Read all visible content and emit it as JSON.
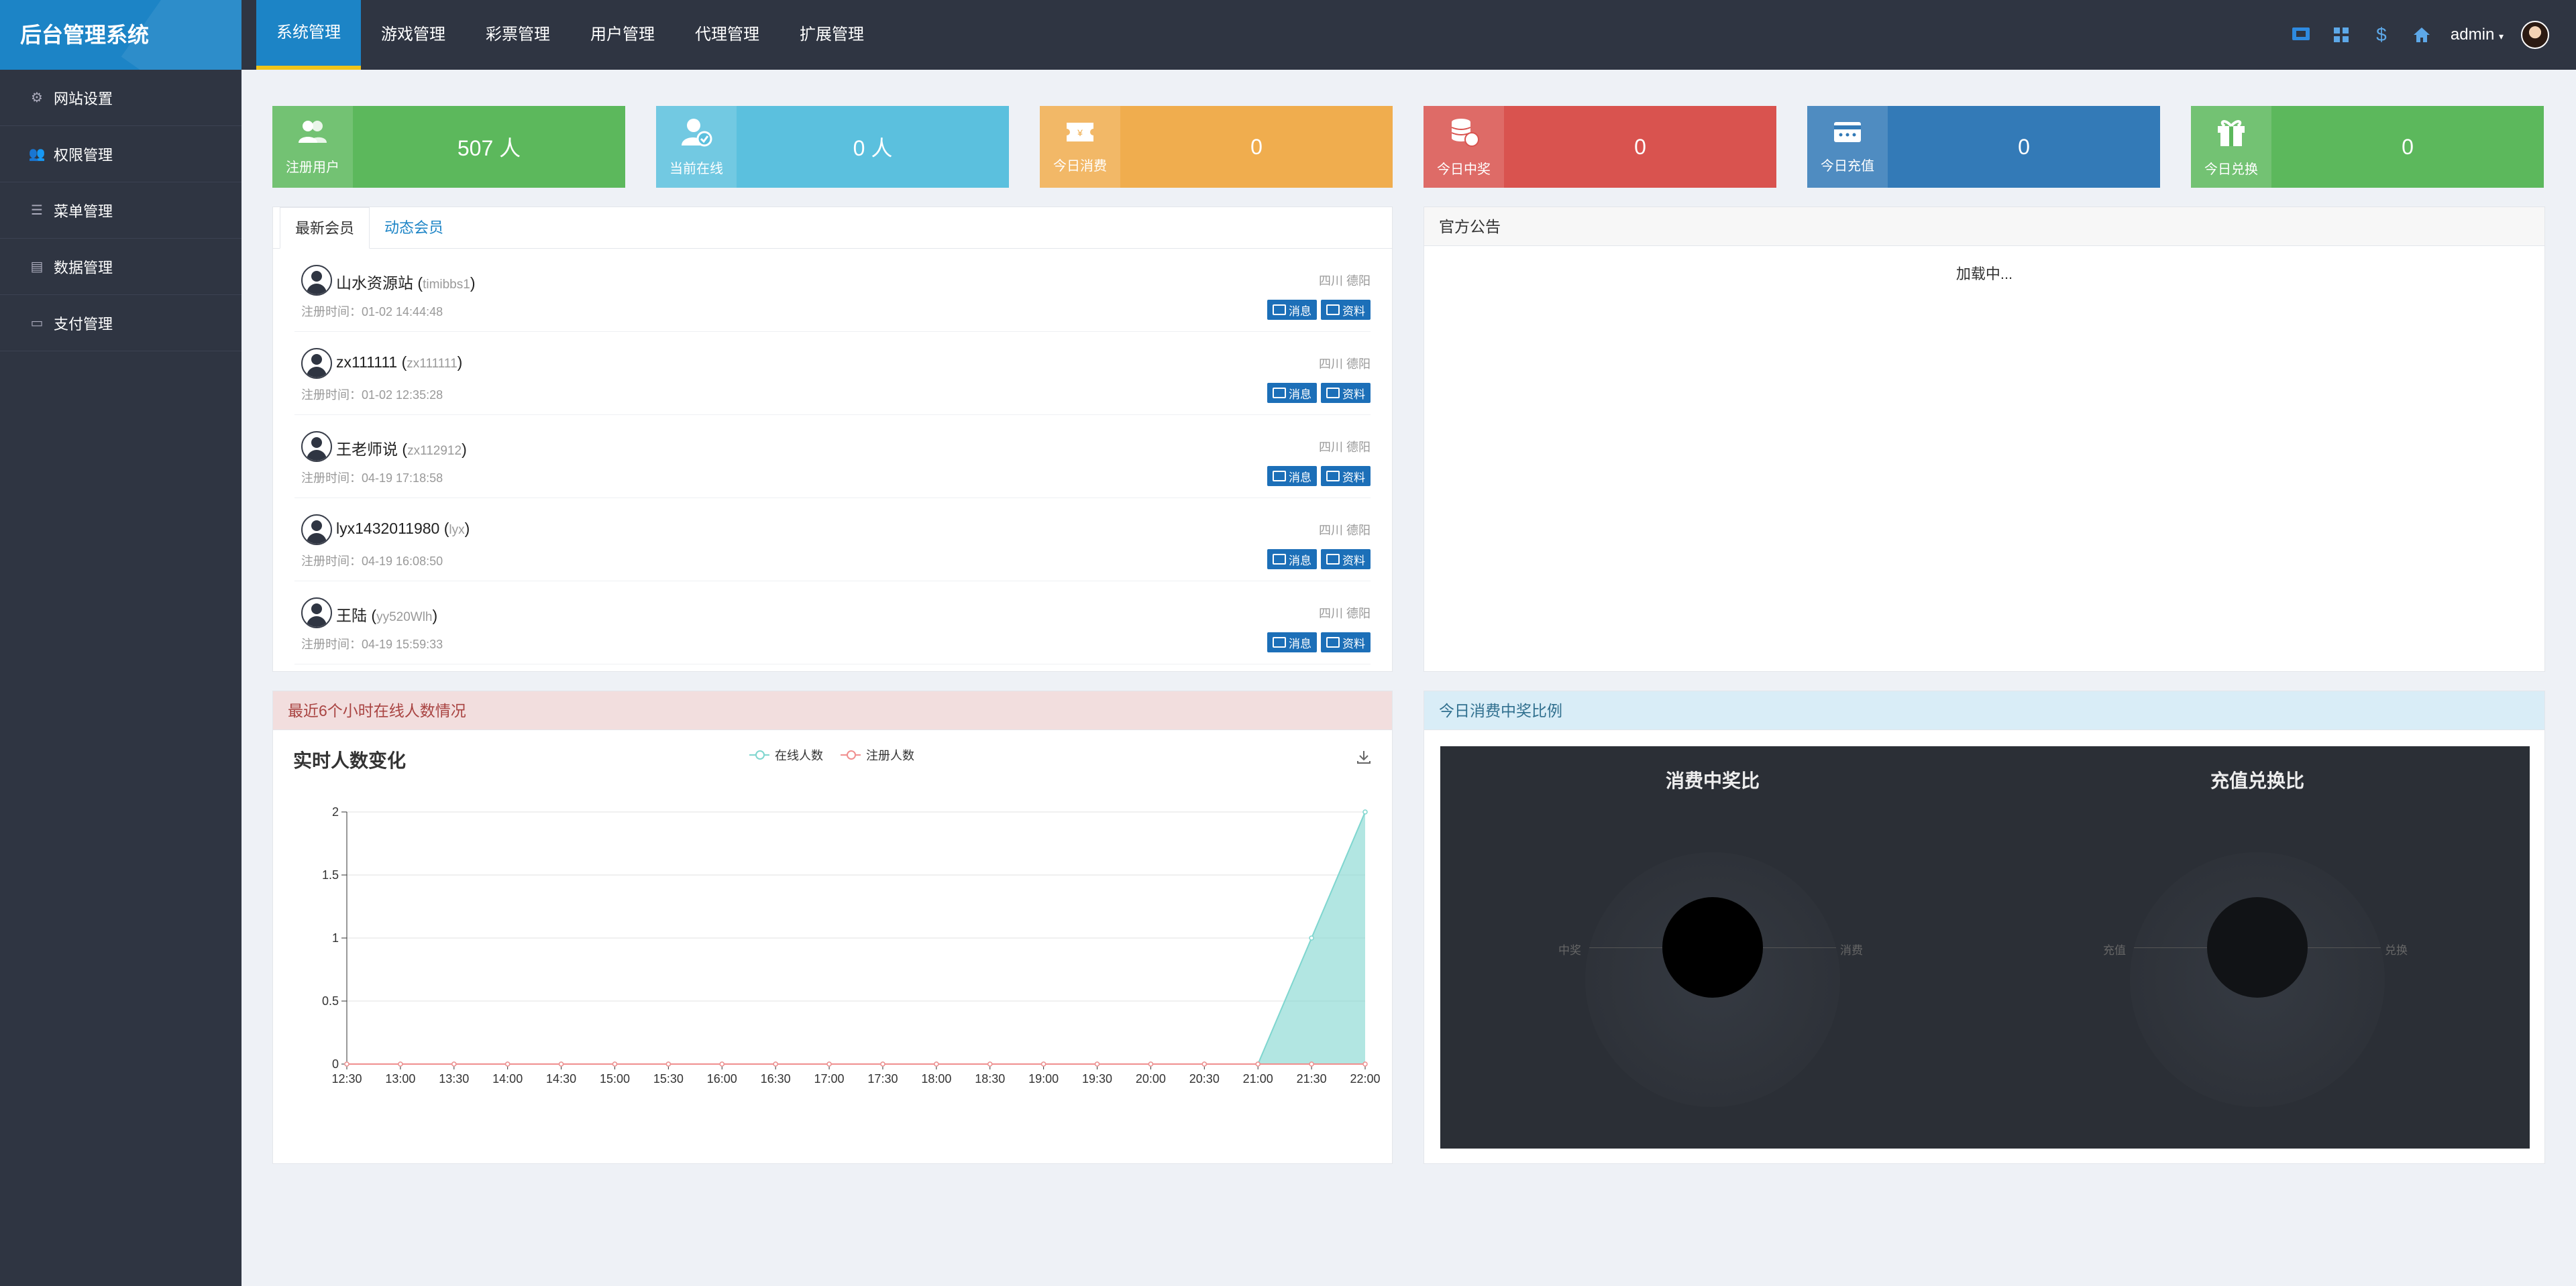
{
  "app": {
    "title": "后台管理系统",
    "user": "admin"
  },
  "topnav": [
    "系统管理",
    "游戏管理",
    "彩票管理",
    "用户管理",
    "代理管理",
    "扩展管理"
  ],
  "topicons": [
    "monitor-icon",
    "grid-icon",
    "dollar-icon",
    "home-icon"
  ],
  "sidebar": [
    "网站设置",
    "权限管理",
    "菜单管理",
    "数据管理",
    "支付管理"
  ],
  "stats": [
    {
      "label": "注册用户",
      "value": "507 人",
      "color": "#5cb85c",
      "icon": "users-icon"
    },
    {
      "label": "当前在线",
      "value": "0 人",
      "color": "#5bc0de",
      "icon": "user-check-icon"
    },
    {
      "label": "今日消费",
      "value": "0",
      "color": "#f0ad4e",
      "icon": "ticket-icon"
    },
    {
      "label": "今日中奖",
      "value": "0",
      "color": "#d9534f",
      "icon": "coins-icon"
    },
    {
      "label": "今日充值",
      "value": "0",
      "color": "#337ab7",
      "icon": "card-icon"
    },
    {
      "label": "今日兑换",
      "value": "0",
      "color": "#5cb85c",
      "icon": "gift-icon"
    }
  ],
  "members": {
    "tabs": [
      "最新会员",
      "动态会员"
    ],
    "rows": [
      {
        "name": "山水资源站",
        "account": "timibbs1",
        "reg_time": "注册时间：01-02 14:44:48",
        "location": "四川 德阳"
      },
      {
        "name": "zx111111",
        "account": "zx111111",
        "reg_time": "注册时间：01-02 12:35:28",
        "location": "四川 德阳"
      },
      {
        "name": "王老师说",
        "account": "zx112912",
        "reg_time": "注册时间：04-19 17:18:58",
        "location": "四川 德阳"
      },
      {
        "name": "lyx1432011980",
        "account": "lyx",
        "reg_time": "注册时间：04-19 16:08:50",
        "location": "四川 德阳"
      },
      {
        "name": "王陆",
        "account": "yy520Wlh",
        "reg_time": "注册时间：04-19 15:59:33",
        "location": "四川 德阳"
      }
    ],
    "btn_message": "消息",
    "btn_profile": "资料"
  },
  "announce": {
    "title": "官方公告",
    "loading": "加载中..."
  },
  "online_panel": {
    "title": "最近6个小时在线人数情况"
  },
  "ratio_panel": {
    "title": "今日消费中奖比例"
  },
  "chart_data": [
    {
      "type": "area",
      "title": "实时人数变化",
      "x": [
        "12:30",
        "13:00",
        "13:30",
        "14:00",
        "14:30",
        "15:00",
        "15:30",
        "16:00",
        "16:30",
        "17:00",
        "17:30",
        "18:00",
        "18:30",
        "19:00",
        "19:30",
        "20:00",
        "20:30",
        "21:00",
        "21:30",
        "22:00"
      ],
      "ylim": [
        0,
        2
      ],
      "yticks": [
        0,
        0.5,
        1,
        1.5,
        2
      ],
      "series": [
        {
          "name": "在线人数",
          "color": "#7fd6cf",
          "values": [
            0,
            0,
            0,
            0,
            0,
            0,
            0,
            0,
            0,
            0,
            0,
            0,
            0,
            0,
            0,
            0,
            0,
            0,
            1,
            2
          ]
        },
        {
          "name": "注册人数",
          "color": "#f08e8e",
          "values": [
            0,
            0,
            0,
            0,
            0,
            0,
            0,
            0,
            0,
            0,
            0,
            0,
            0,
            0,
            0,
            0,
            0,
            0,
            0,
            0
          ]
        }
      ],
      "legend": "top-center",
      "grid": true
    },
    {
      "type": "pie",
      "title": "消费中奖比",
      "labels": [
        "中奖",
        "消费"
      ],
      "values": [
        0,
        0
      ],
      "color": "#000000"
    },
    {
      "type": "pie",
      "title": "充值兑换比",
      "labels": [
        "充值",
        "兑换"
      ],
      "values": [
        0,
        0
      ],
      "color": "#111316"
    }
  ]
}
